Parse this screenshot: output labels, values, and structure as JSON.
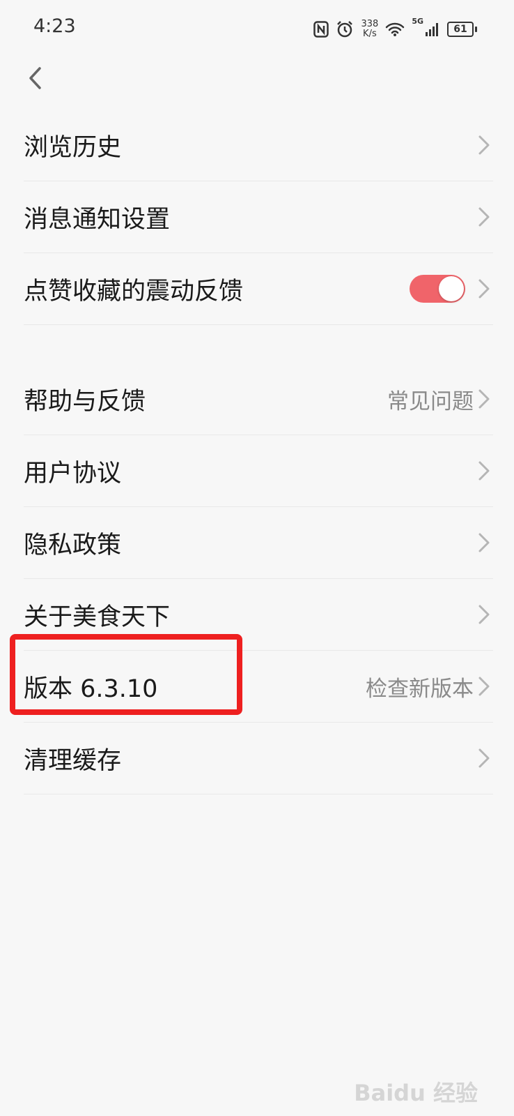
{
  "status_bar": {
    "time": "4:23",
    "net_speed_value": "338",
    "net_speed_unit": "K/s",
    "network_label": "5G",
    "battery": "61"
  },
  "colors": {
    "toggle_on": "#f0646a",
    "highlight": "#ee2020",
    "chevron": "#b5b5b5"
  },
  "group1": [
    {
      "label": "浏览历史"
    },
    {
      "label": "消息通知设置"
    },
    {
      "label": "点赞收藏的震动反馈",
      "toggle_on": true
    }
  ],
  "group2": [
    {
      "label": "帮助与反馈",
      "right": "常见问题"
    },
    {
      "label": "用户协议"
    },
    {
      "label": "隐私政策"
    },
    {
      "label": "关于美食天下"
    },
    {
      "label": "版本 6.3.10",
      "right": "检查新版本"
    },
    {
      "label": "清理缓存"
    }
  ],
  "watermark": "Baidu 经验"
}
